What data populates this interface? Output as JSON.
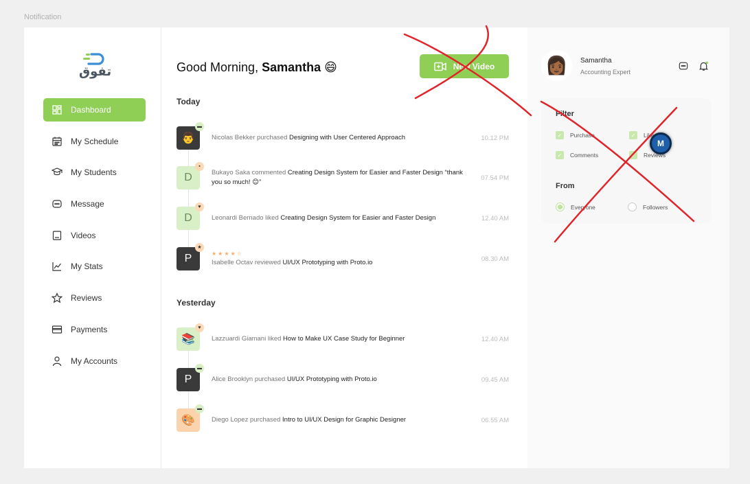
{
  "frame_label": "Notification",
  "brand": {
    "logo_text": "تفوق",
    "accent": "#8fcf56"
  },
  "sidebar": {
    "items": [
      {
        "label": "Dashboard",
        "icon": "dashboard-icon",
        "active": true
      },
      {
        "label": "My Schedule",
        "icon": "calendar-icon"
      },
      {
        "label": "My Students",
        "icon": "graduation-cap-icon"
      },
      {
        "label": "Message",
        "icon": "message-icon"
      },
      {
        "label": "Videos",
        "icon": "video-icon"
      },
      {
        "label": "My Stats",
        "icon": "stats-icon"
      },
      {
        "label": "Reviews",
        "icon": "star-icon"
      },
      {
        "label": "Payments",
        "icon": "wallet-icon"
      },
      {
        "label": "My Accounts",
        "icon": "user-icon"
      }
    ]
  },
  "header": {
    "greeting": "Good Morning, ",
    "user_name": "Samantha",
    "emoji": "😄",
    "new_video_label": "New Video"
  },
  "notifications": {
    "today_label": "Today",
    "yesterday_label": "Yesterday",
    "today": [
      {
        "avatar": "👨",
        "avatar_style": "dark",
        "badge": "▬",
        "badge_style": "green",
        "actor": "Nicolas Bekker",
        "action": " purchased ",
        "subject": "Designing with User Centered Approach",
        "time": "10.12 PM"
      },
      {
        "avatar": "D",
        "avatar_style": "green",
        "badge": "▪",
        "badge_style": "peach",
        "actor": "Bukayo Saka",
        "action": " commented ",
        "subject": "Creating Design System for Easier and Faster Design “thank you so much! 😊”",
        "time": "07.54 PM"
      },
      {
        "avatar": "D",
        "avatar_style": "green",
        "badge": "♥",
        "badge_style": "peach",
        "actor": "Leonardi Bernado",
        "action": " liked ",
        "subject": "Creating Design System for Easier and Faster Design",
        "time": "12.40 AM"
      },
      {
        "avatar": "P",
        "avatar_style": "dark",
        "badge": "★",
        "badge_style": "peach",
        "stars": "★★★★☆",
        "actor": "Isabelle Octav",
        "action": " reviewed ",
        "subject": "UI/UX Prototyping with Proto.io",
        "time": "08.30 AM"
      }
    ],
    "yesterday": [
      {
        "avatar": "📚",
        "avatar_style": "green",
        "badge": "♥",
        "badge_style": "peach",
        "actor": "Lazzuardi Giamani",
        "action": " liked ",
        "subject": "How to Make UX Case Study for Beginner",
        "time": "12.40 AM"
      },
      {
        "avatar": "P",
        "avatar_style": "dark",
        "badge": "▬",
        "badge_style": "green",
        "actor": "Alice Brooklyn",
        "action": " purchased ",
        "subject": "UI/UX Prototyping with Proto.io",
        "time": "09.45 AM"
      },
      {
        "avatar": "🎨",
        "avatar_style": "orange",
        "badge": "▬",
        "badge_style": "green",
        "actor": "Diego Lopez",
        "action": " purchased ",
        "subject": "Intro to UI/UX Design for Graphic Designer",
        "time": "06.55 AM"
      }
    ]
  },
  "profile": {
    "avatar": "👩🏾",
    "name": "Samantha",
    "role": "Accounting Expert"
  },
  "filter": {
    "title": "Filter",
    "options": [
      {
        "label": "Purchase",
        "checked": true
      },
      {
        "label": "Likes",
        "checked": true
      },
      {
        "label": "Comments",
        "checked": true
      },
      {
        "label": "Reviews",
        "checked": true
      }
    ],
    "from_title": "From",
    "from_options": [
      {
        "label": "Everyone",
        "selected": true
      },
      {
        "label": "Followers",
        "selected": false
      }
    ]
  },
  "cursor_badge": "M",
  "annotation_color": "#e0242a"
}
